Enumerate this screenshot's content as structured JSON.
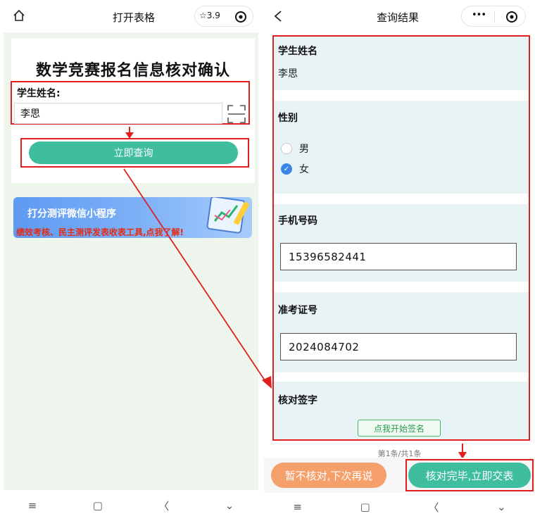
{
  "left": {
    "title": "打开表格",
    "rating": "☆3.9",
    "heading": "数学竞赛报名信息核对确认",
    "name_label": "学生姓名:",
    "name_value": "李思",
    "query_button": "立即查询",
    "banner": {
      "title": "打分测评微信小程序",
      "subtitle": "绩效考核、民主测评发表收表工具,点我了解!"
    },
    "nav": [
      "≡",
      "▢",
      "〈",
      "⌄"
    ]
  },
  "right": {
    "title": "查询结果",
    "more": "•••",
    "student_name_label": "学生姓名",
    "student_name_value": "李思",
    "gender_label": "性别",
    "gender_options": [
      "男",
      "女"
    ],
    "gender_selected": "女",
    "phone_label": "手机号码",
    "phone_value": "15396582441",
    "exam_id_label": "准考证号",
    "exam_id_value": "2024084702",
    "sign_label": "核对签字",
    "sign_button": "点我开始签名",
    "pagination": "第1条/共1条",
    "defer_button": "暂不核对,下次再说",
    "confirm_button": "核对完毕,立即交表",
    "nav": [
      "≡",
      "▢",
      "〈",
      "⌄"
    ]
  },
  "colors": {
    "accent_green": "#3ebd9f",
    "highlight_red": "#e02020",
    "orange": "#f5a06b",
    "section_bg": "#e8f3f5"
  }
}
